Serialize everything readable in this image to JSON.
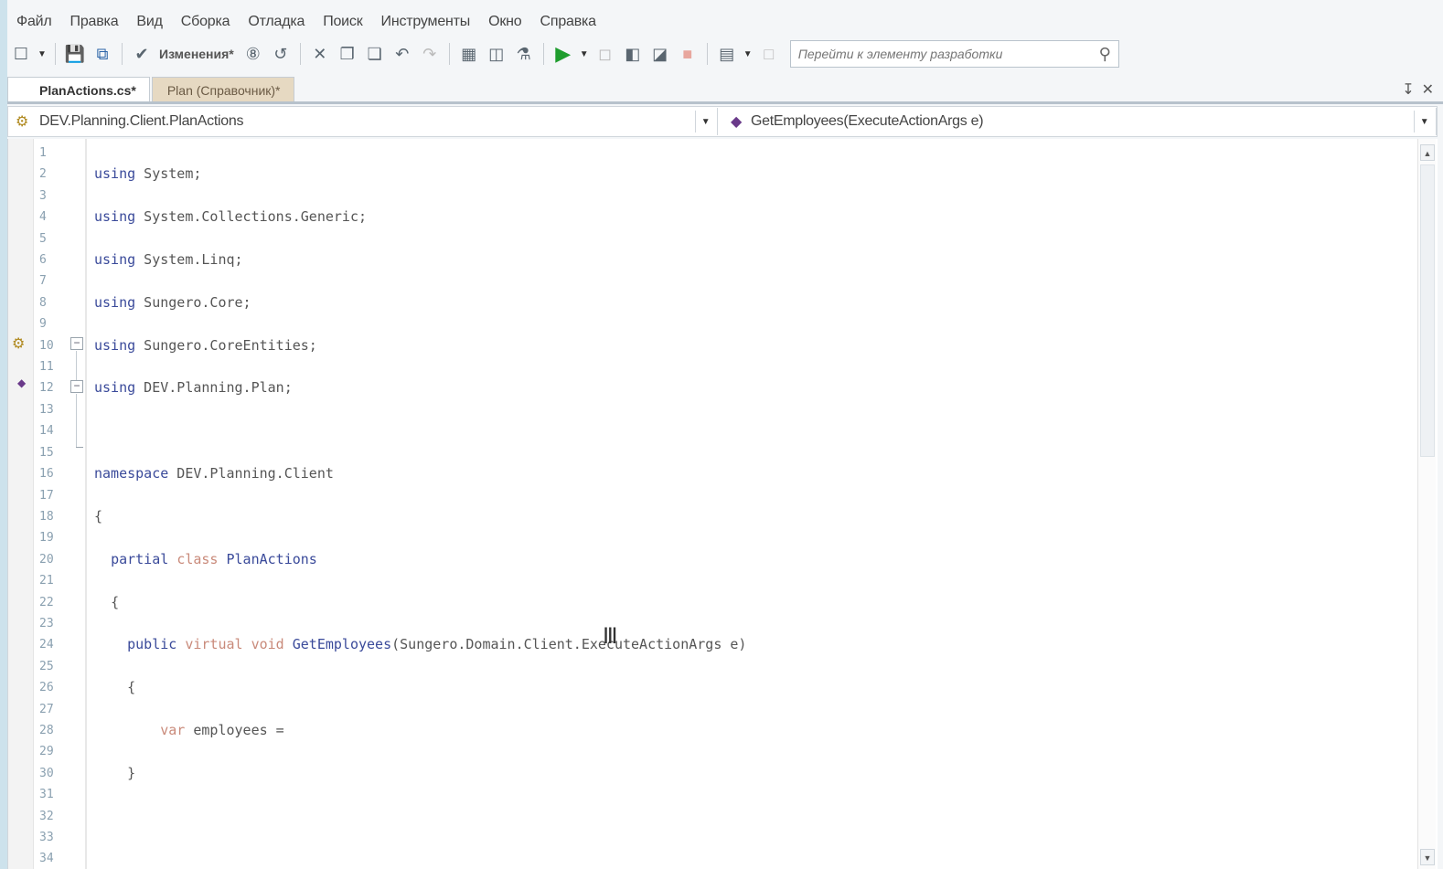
{
  "menu": {
    "items": [
      "Файл",
      "Правка",
      "Вид",
      "Сборка",
      "Отладка",
      "Поиск",
      "Инструменты",
      "Окно",
      "Справка"
    ]
  },
  "toolbar": {
    "changes_label": "Изменения*",
    "search_placeholder": "Перейти к элементу разработки"
  },
  "tabs": [
    {
      "label": "PlanActions.cs*",
      "active": true
    },
    {
      "label": "Plan (Справочник)*",
      "active": false
    }
  ],
  "navigation": {
    "type_selector": "DEV.Planning.Client.PlanActions",
    "member_selector": "GetEmployees(ExecuteActionArgs e)"
  },
  "editor": {
    "line_numbers": [
      "1",
      "2",
      "3",
      "4",
      "5",
      "6",
      "7",
      "8",
      "9",
      "10",
      "11",
      "12",
      "13",
      "14",
      "15",
      "16",
      "17",
      "18",
      "19",
      "20",
      "21",
      "22",
      "23",
      "24",
      "25",
      "26",
      "27",
      "28",
      "29",
      "30",
      "31",
      "32",
      "33",
      "34"
    ],
    "lines": [
      {
        "kw": "using",
        "rest": " System;"
      },
      {
        "kw": "using",
        "rest": " System.Collections.Generic;"
      },
      {
        "kw": "using",
        "rest": " System.Linq;"
      },
      {
        "kw": "using",
        "rest": " Sungero.Core;"
      },
      {
        "kw": "using",
        "rest": " Sungero.CoreEntities;"
      },
      {
        "kw": "using",
        "rest": " DEV.Planning.Plan;"
      },
      {
        "kw": "",
        "rest": ""
      },
      {
        "kw": "namespace",
        "rest": " DEV.Planning.Client"
      },
      {
        "kw": "",
        "rest": "{"
      }
    ],
    "class_line": {
      "kw1": "partial",
      "kw2": "class",
      "name": "PlanActions"
    },
    "open_brace_1": "{",
    "method_line": {
      "kw1": "public",
      "kw2": "virtual",
      "kw3": "void",
      "name": "GetEmployees",
      "params": "(Sungero.Domain.Client.ExecuteActionArgs e)"
    },
    "open_brace_2": "{",
    "body_line": {
      "kw": "var",
      "rest": " employees ="
    },
    "close_brace": "}"
  },
  "colors": {
    "keyword": "#3a4a9a",
    "keyword_light": "#c98a7a",
    "run_button": "#1f9d2e",
    "active_tab_bg": "#ffffff",
    "inactive_tab_bg": "#e6d9c2"
  },
  "icons": {
    "new": "new-file-icon",
    "save": "save-icon",
    "save_all": "save-all-icon",
    "check": "check-circle-icon",
    "run": "play-icon",
    "search": "search-icon"
  }
}
